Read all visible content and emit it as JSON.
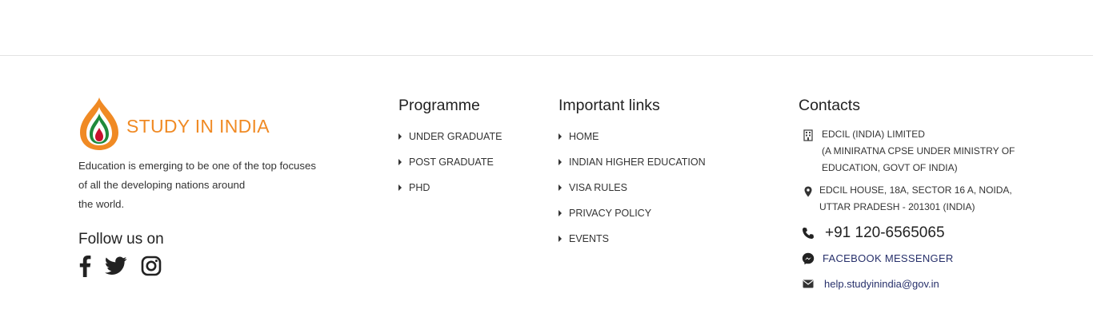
{
  "brand": {
    "logo_text": "STUDY IN INDIA",
    "tagline_lines": [
      "Education is emerging to be one of the top focuses",
      "of all the developing nations around",
      "the world."
    ],
    "follow_label": "Follow us on",
    "socials": [
      "facebook-icon",
      "twitter-icon",
      "instagram-icon"
    ],
    "accent_color": "#f08a24"
  },
  "programme": {
    "heading": "Programme",
    "items": [
      "UNDER GRADUATE",
      "POST GRADUATE",
      "PHD"
    ]
  },
  "important": {
    "heading": "Important links",
    "items": [
      "HOME",
      "INDIAN HIGHER EDUCATION",
      "VISA RULES",
      "PRIVACY POLICY",
      "EVENTS"
    ]
  },
  "contacts": {
    "heading": "Contacts",
    "org_lines": [
      "EDCIL (INDIA) LIMITED",
      "(A MINIRATNA CPSE UNDER MINISTRY OF",
      "EDUCATION, GOVT OF INDIA)"
    ],
    "address_lines": [
      "EDCIL HOUSE, 18A, SECTOR 16 A, NOIDA,",
      "UTTAR PRADESH - 201301 (INDIA)"
    ],
    "phone": "+91 120-6565065",
    "messenger": "FACEBOOK MESSENGER",
    "email": "help.studyinindia@gov.in",
    "link_color": "#27306b"
  }
}
